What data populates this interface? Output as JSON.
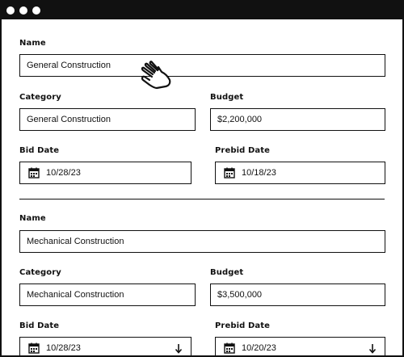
{
  "window": {
    "titlebar_color": "#111111"
  },
  "section1": {
    "name_label": "Name",
    "name_value": "General Construction",
    "category_label": "Category",
    "category_value": "General Construction",
    "budget_label": "Budget",
    "budget_value": "$2,200,000",
    "bid_date_label": "Bid Date",
    "bid_date_value": "10/28/23",
    "prebid_date_label": "Prebid Date",
    "prebid_date_value": "10/18/23"
  },
  "section2": {
    "name_label": "Name",
    "name_value": "Mechanical Construction",
    "category_label": "Category",
    "category_value": "Mechanical Construction",
    "budget_label": "Budget",
    "budget_value": "$3,500,000",
    "bid_date_label": "Bid Date",
    "bid_date_value": "10/28/23",
    "prebid_date_label": "Prebid Date",
    "prebid_date_value": "10/20/23"
  },
  "icons": {
    "calendar": "calendar-icon",
    "arrow": "arrow-down-icon",
    "cursor": "hand-pointer-icon"
  }
}
